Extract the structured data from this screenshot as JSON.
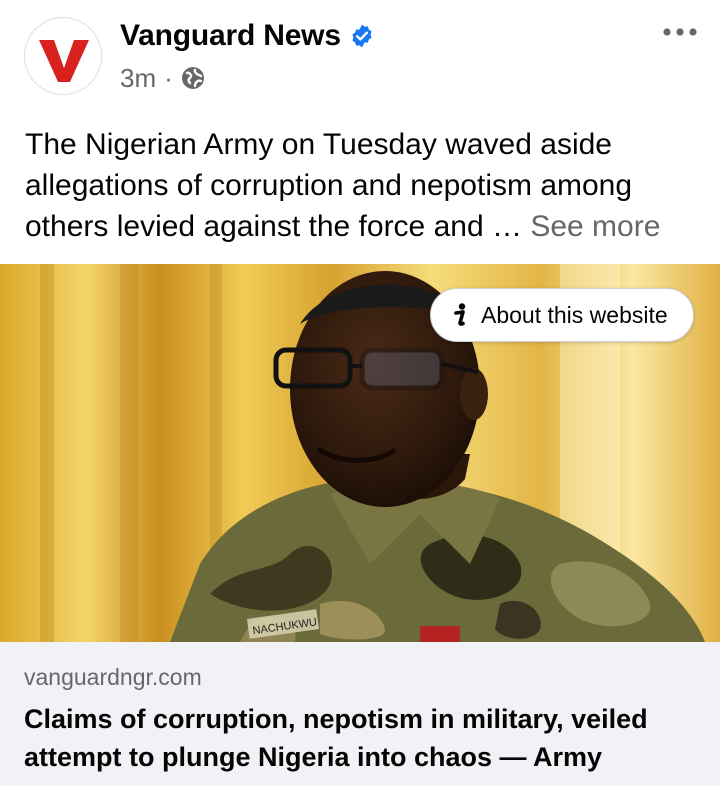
{
  "post": {
    "page_name": "Vanguard News",
    "avatar_letter": "V",
    "verified_icon": "verified-badge-icon",
    "timestamp": "3m",
    "separator": "·",
    "audience_icon": "globe-icon",
    "more_icon": "more-horizontal-icon",
    "body_text": "The Nigerian Army on Tuesday waved aside allegations of corruption and nepotism among others levied against the force and …",
    "see_more_label": "See more"
  },
  "image": {
    "description_icon": "photo",
    "uniform_tag": "NACHUKWU",
    "about_website_label": "About this website",
    "about_icon": "info-icon"
  },
  "link": {
    "domain": "vanguardngr.com",
    "title": "Claims of corruption, nepotism in military, veiled attempt to plunge Nigeria into chaos — Army"
  },
  "colors": {
    "brand_red": "#d7221f",
    "verified_blue": "#1877f2",
    "secondary_text": "#65676b",
    "link_card_bg": "#f0f2f5"
  }
}
